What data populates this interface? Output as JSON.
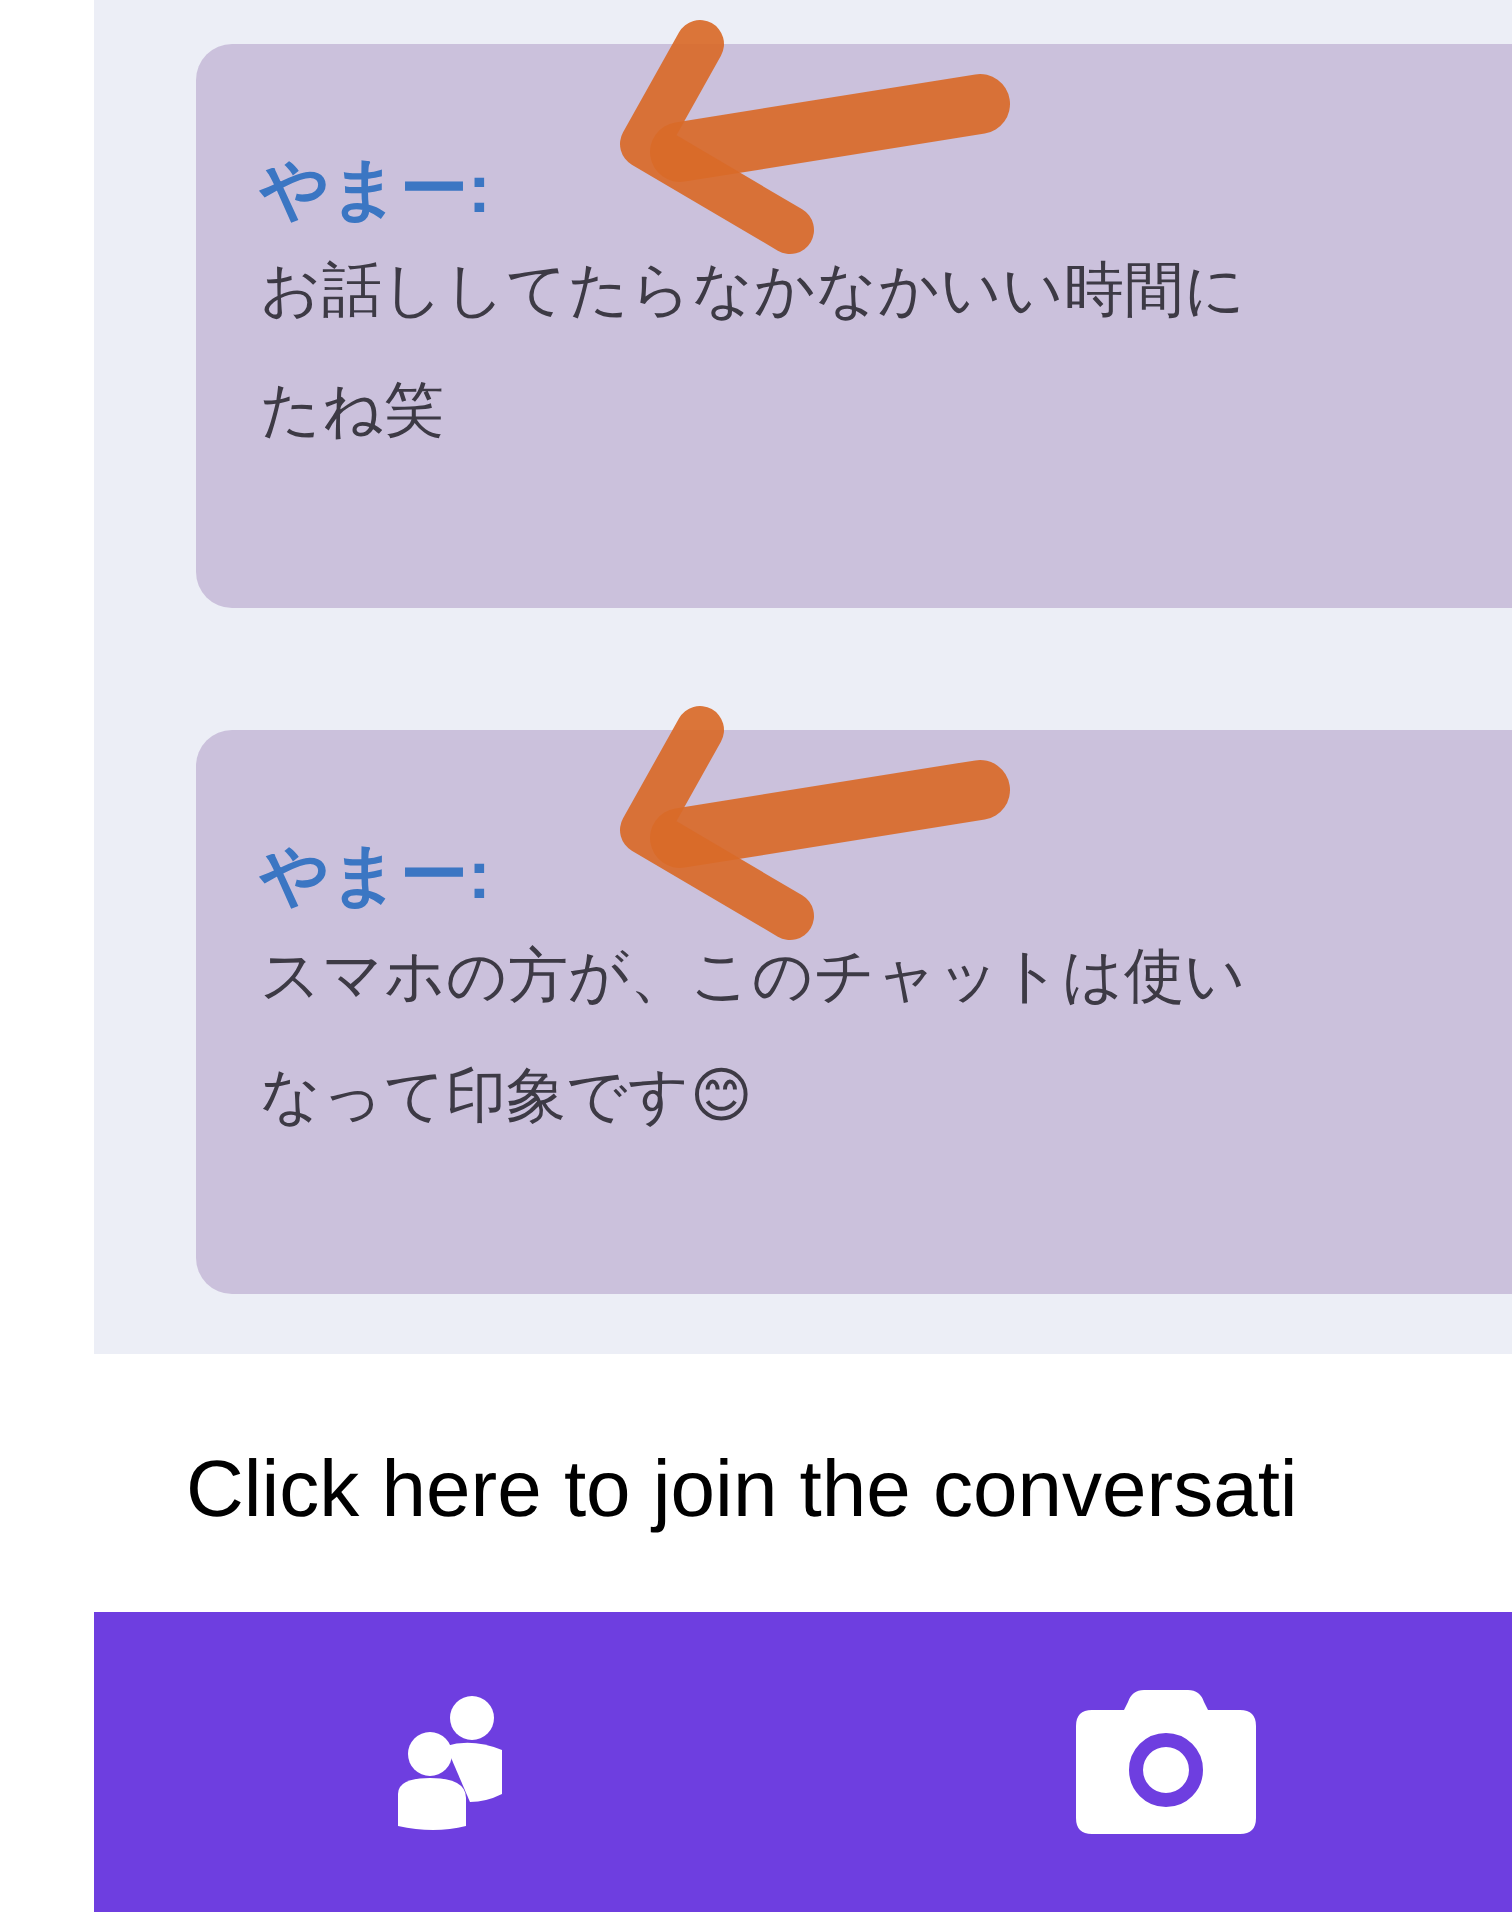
{
  "messages": [
    {
      "author": "やまー:",
      "lines": [
        "お話ししてたらなかなかいい時間に",
        "たね笑"
      ],
      "marked": true
    },
    {
      "author": "やまー:",
      "lines": [
        "スマホの方が、このチャットは使い",
        "なって印象です😊"
      ],
      "marked": true
    }
  ],
  "join_link": "Click here to join the conversati",
  "nav": [
    {
      "kind": "people"
    },
    {
      "kind": "camera"
    }
  ]
}
